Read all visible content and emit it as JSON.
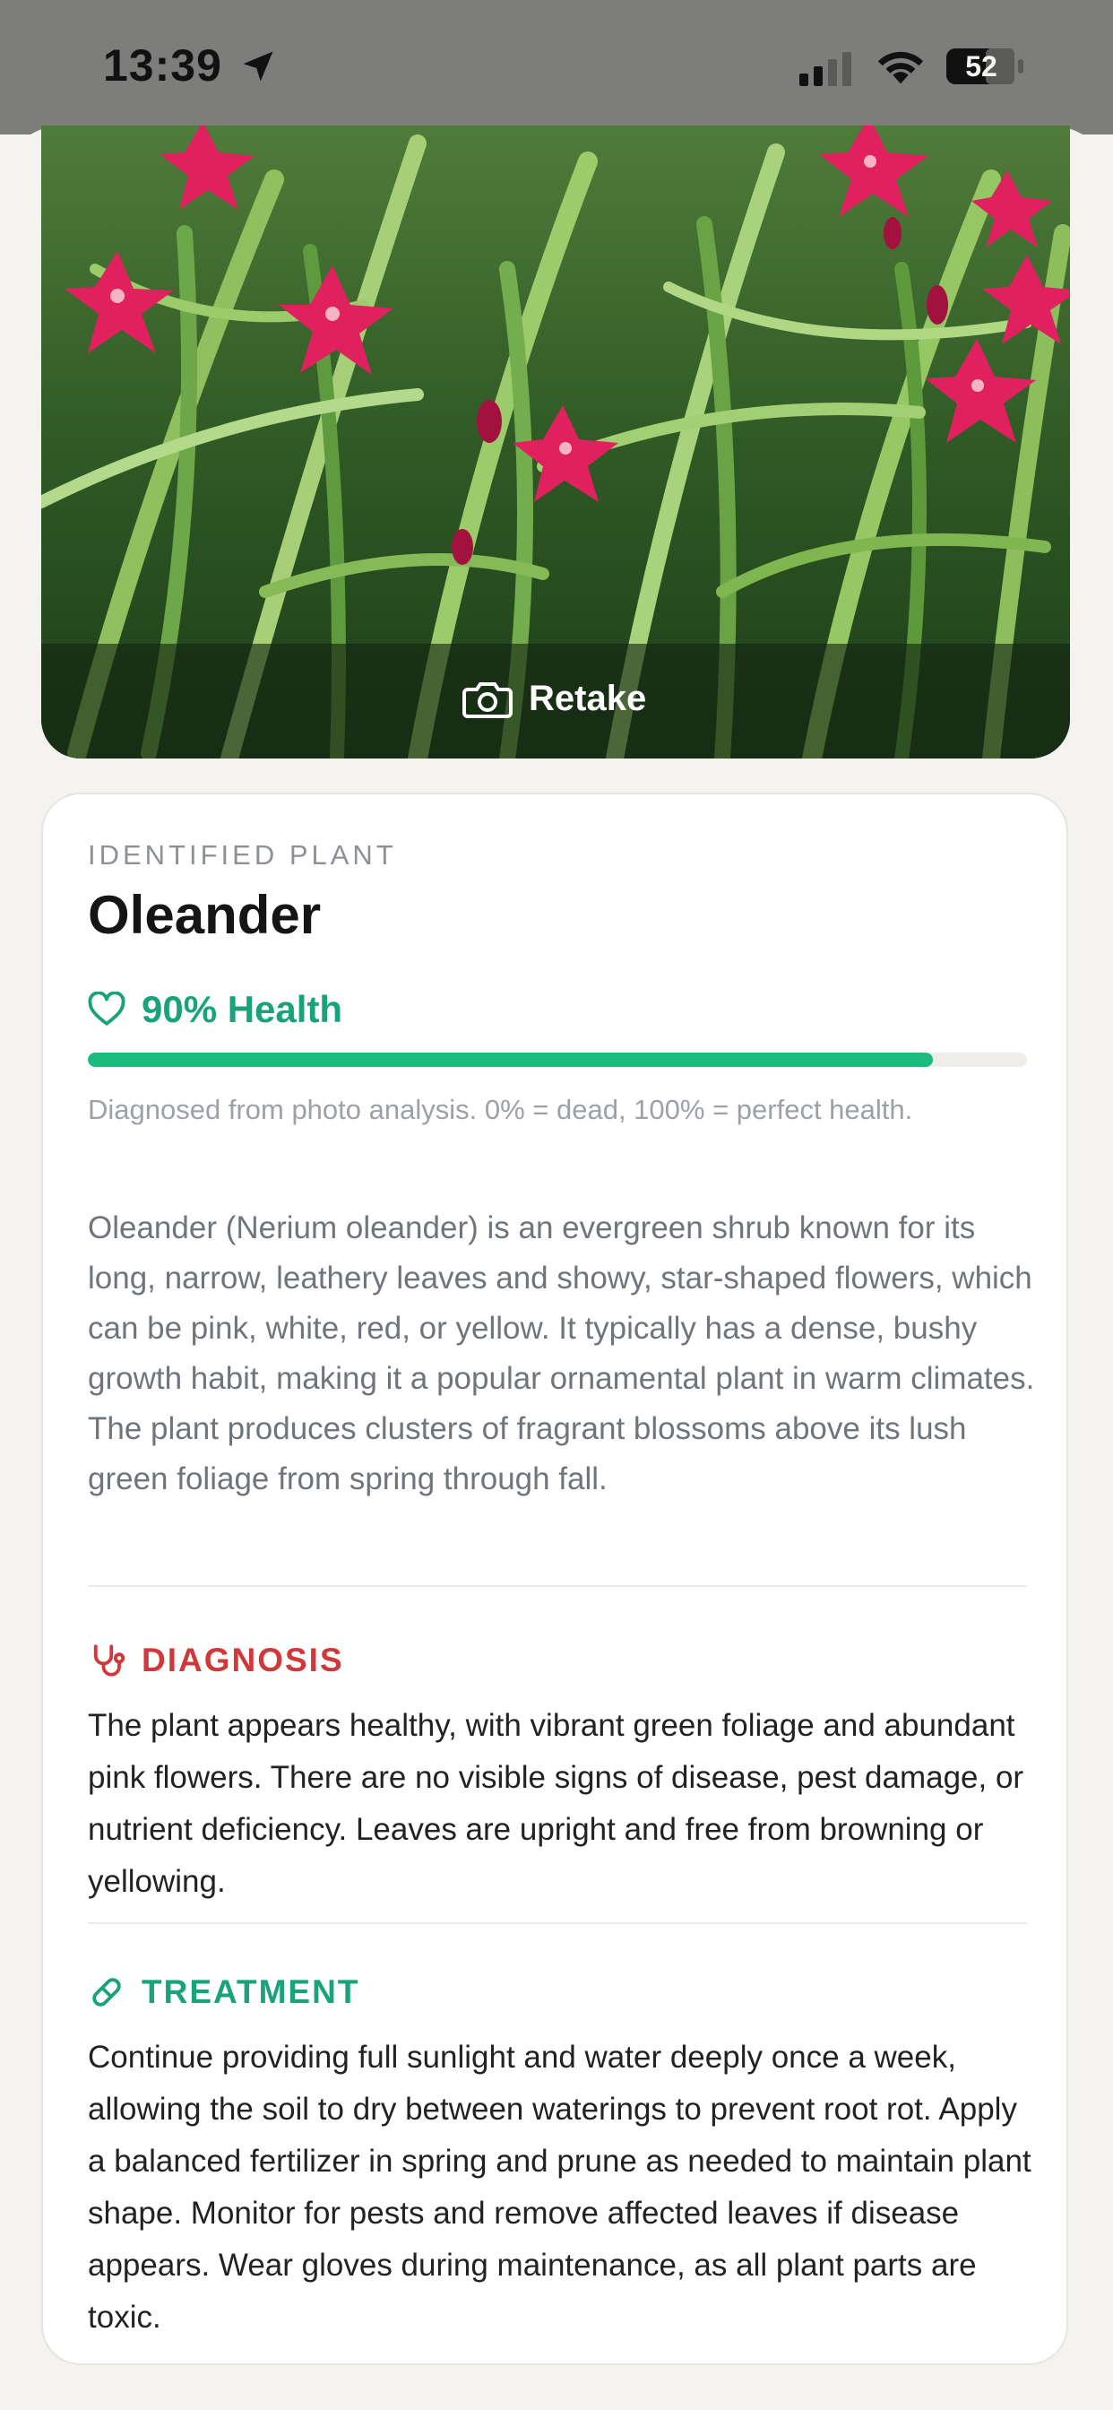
{
  "status_bar": {
    "time": "13:39",
    "battery": "52"
  },
  "photo": {
    "retake_label": "Retake"
  },
  "plant": {
    "overline": "IDENTIFIED PLANT",
    "name": "Oleander",
    "health_label": "90% Health",
    "health_value": 0.9,
    "health_note": "Diagnosed from photo analysis. 0% = dead, 100% = perfect health.",
    "description": "Oleander (Nerium oleander) is an evergreen shrub known for its long, narrow, leathery leaves and showy, star-shaped flowers, which can be pink, white, red, or yellow. It typically has a dense, bushy growth habit, making it a popular ornamental plant in warm climates. The plant produces clusters of fragrant blossoms above its lush green foliage from spring through fall."
  },
  "diagnosis": {
    "title": "DIAGNOSIS",
    "body": "The plant appears healthy, with vibrant green foliage and abundant pink flowers. There are no visible signs of disease, pest damage, or nutrient deficiency. Leaves are upright and free from browning or yellowing."
  },
  "treatment": {
    "title": "TREATMENT",
    "body": "Continue providing full sunlight and water deeply once a week, allowing the soil to dry between waterings to prevent root rot. Apply a balanced fertilizer in spring and prune as needed to maintain plant shape. Monitor for pests and remove affected leaves if disease appears. Wear gloves during maintenance, as all plant parts are toxic."
  },
  "colors": {
    "health_green": "#1aa27a",
    "progress_green": "#1dba7e",
    "diagnosis_red": "#d0383a",
    "treatment_green": "#1aa27a",
    "background": "#f4f3ef"
  },
  "icons": {
    "location": "location-arrow-icon",
    "signal": "cellular-signal-icon",
    "wifi": "wifi-icon",
    "battery": "battery-icon",
    "camera": "camera-icon",
    "heart": "heart-icon",
    "stethoscope": "stethoscope-icon",
    "pill": "pill-icon"
  }
}
